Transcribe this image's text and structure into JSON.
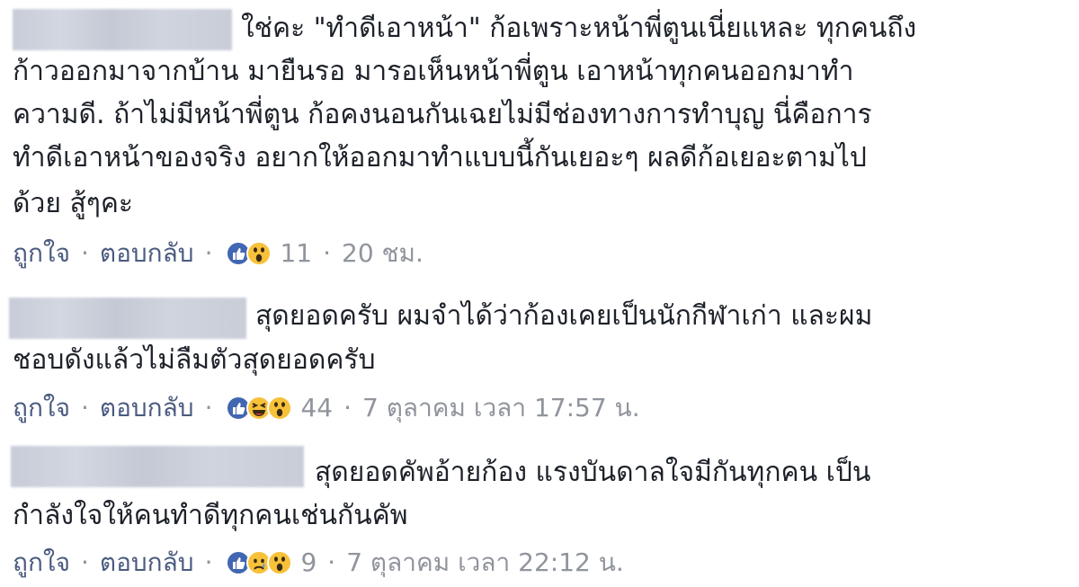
{
  "comments": [
    {
      "lines": [
        "ใช่คะ \"ทำดีเอาหน้า\" ก้อเพราะหน้าพี่ตูนเนี่ยแหละ ทุกคนถึง",
        "ก้าวออกมาจากบ้าน มายืนรอ มารอเห็นหน้าพี่ตูน เอาหน้าทุกคนออกมาทำ",
        "ความดี. ถ้าไม่มีหน้าพี่ตูน ก้อคงนอนกันเฉยไม่มีช่องทางการทำบุญ นี่คือการ",
        "ทำดีเอาหน้าของจริง อยากให้ออกมาทำแบบนี้กันเยอะๆ ผลดีก้อเยอะตามไป",
        "ด้วย สู้ๆคะ"
      ],
      "like": "ถูกใจ",
      "reply": "ตอบกลับ",
      "reactions": [
        "like-reaction-icon",
        "wow-reaction-icon"
      ],
      "count": "11",
      "time": "20 ชม."
    },
    {
      "lines": [
        "สุดยอดครับ ผมจำได้ว่าก้องเคยเป็นนักกีฬาเก่า และผม",
        "ชอบดังแล้วไม่ลืมตัวสุดยอดครับ"
      ],
      "like": "ถูกใจ",
      "reply": "ตอบกลับ",
      "reactions": [
        "like-reaction-icon",
        "haha-reaction-icon",
        "wow-reaction-icon"
      ],
      "count": "44",
      "time": "7 ตุลาคม เวลา 17:57 น."
    },
    {
      "lines": [
        "สุดยอดคัพอ้ายก้อง แรงบันดาลใจมีกันทุกคน เป็น",
        "กำลังใจให้คนทำดีทุกคนเช่นกันคัพ"
      ],
      "like": "ถูกใจ",
      "reply": "ตอบกลับ",
      "reactions": [
        "like-reaction-icon",
        "sad-reaction-icon",
        "wow-reaction-icon"
      ],
      "count": "9",
      "time": "7 ตุลาคม เวลา 22:12 น."
    }
  ],
  "separator": "·",
  "colors": {
    "text": "#1d2129",
    "link": "#4b5b80",
    "muted": "#90949c",
    "like_blue": "#4267b2",
    "emoji_yellow": "#f7c13a"
  }
}
